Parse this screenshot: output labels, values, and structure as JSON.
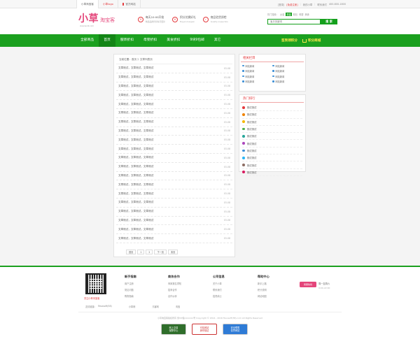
{
  "topbar": {
    "items": [
      "小草淘宝客",
      "小草logo",
      "官方网站"
    ],
    "right": [
      "[登录]",
      "[免费注册]",
      "我的小草",
      "联系我们",
      "400-800-1800"
    ]
  },
  "header": {
    "logo_big": "小草",
    "logo_small": "淘宝客",
    "logo_url": "xiaocao-tk.com",
    "features": [
      {
        "icon": "9",
        "title": "每天10:00开抢",
        "sub": "精选品牌折扣每天更新"
      },
      {
        "icon": "¥",
        "title": "积分兑换好礼",
        "sub": "Buyers bargain"
      },
      {
        "icon": "✓",
        "title": "商品验货质检",
        "sub": "Quality inspection"
      }
    ],
    "hot_search_label": "热门搜索：",
    "hot_search": [
      "女装",
      "男装",
      "鞋包",
      "母婴",
      "美食"
    ],
    "search_placeholder": "宝贝关键词",
    "search_button": "搜 索"
  },
  "nav": {
    "items": [
      "全部商品",
      "首页",
      "服饰折扣",
      "母婴折扣",
      "美食折扣",
      "9块9包邮",
      "其它"
    ],
    "active_index": 1,
    "right": [
      "签到领积分",
      "积分商城"
    ],
    "accent": "#1ba01f"
  },
  "main": {
    "breadcrumb": "当前位置：首页 》文章列表页",
    "articles": [
      {
        "title": "文章测试，文章测试，文章测试",
        "date": "03-08"
      },
      {
        "title": "文章测试，文章测试，文章测试",
        "date": "03-08"
      },
      {
        "title": "文章测试，文章测试，文章测试",
        "date": "03-08"
      },
      {
        "title": "文章测试，文章测试，文章测试",
        "date": "03-08"
      },
      {
        "title": "文章测试，文章测试，文章测试",
        "date": "03-08"
      },
      {
        "title": "文章测试，文章测试，文章测试",
        "date": "03-08"
      },
      {
        "title": "文章测试，文章测试，文章测试",
        "date": "03-08"
      },
      {
        "title": "文章测试，文章测试，文章测试",
        "date": "03-08"
      },
      {
        "title": "文章测试，文章测试，文章测试",
        "date": "03-08"
      },
      {
        "title": "文章测试，文章测试，文章测试",
        "date": "03-08"
      },
      {
        "title": "文章测试，文章测试，文章测试",
        "date": "03-08"
      },
      {
        "title": "文章测试，文章测试，文章测试",
        "date": "03-08"
      },
      {
        "title": "文章测试，文章测试，文章测试",
        "date": "03-08"
      },
      {
        "title": "文章测试，文章测试，文章测试",
        "date": "03-08"
      },
      {
        "title": "文章测试，文章测试，文章测试",
        "date": "03-08"
      },
      {
        "title": "文章测试，文章测试，文章测试",
        "date": "03-08"
      },
      {
        "title": "文章测试，文章测试，文章测试",
        "date": "03-08"
      },
      {
        "title": "文章测试，文章测试，文章测试",
        "date": "03-08"
      },
      {
        "title": "文章测试，文章测试，文章测试",
        "date": "03-08"
      },
      {
        "title": "文章测试，文章测试，文章测试",
        "date": "03-08"
      }
    ],
    "pager": [
      "首页",
      "1",
      "2",
      "下一页",
      "末页"
    ]
  },
  "sidebar": {
    "related_title": "相关栏目",
    "related": [
      "网站新闻",
      "网站新闻",
      "网站新闻",
      "网站新闻",
      "网站新闻",
      "网站新闻",
      "网站新闻",
      "网站新闻"
    ],
    "rank_title": "热门排行",
    "rank": [
      "测试测试",
      "测试测试",
      "测试测试",
      "测试测试",
      "测试测试",
      "测试测试",
      "测试测试",
      "测试测试",
      "测试测试",
      "测试测试"
    ],
    "rank_colors": [
      "#e4393c",
      "#f08300",
      "#f5b800",
      "#4caf50",
      "#26a69a",
      "#ab47bc",
      "#3d8fd6",
      "#29b6f6",
      "#8d6e63",
      "#d81b60"
    ]
  },
  "footer": {
    "qr_label": "关注小草淘宝客",
    "columns": [
      {
        "title": "新手指南",
        "links": [
          "用户注册",
          "常见问题",
          "购物指南"
        ]
      },
      {
        "title": "商务合作",
        "links": [
          "商家报名须知",
          "招商合作",
          "合作伙伴"
        ]
      },
      {
        "title": "公司信息",
        "links": [
          "关于小草",
          "联系我们",
          "招贤纳士"
        ]
      },
      {
        "title": "帮助中心",
        "links": [
          "新手上路",
          "积分说明",
          "网站地图"
        ]
      }
    ],
    "tel_box": "客服热线",
    "tel_a": "周一至周六",
    "tel_b": "9:00-22:00",
    "links_label": "友情链接：",
    "links": [
      "Favosoft(58)",
      "小草网",
      "凡客网",
      "淘宝"
    ],
    "copyright": "小草淘宝客版权所有 浙ICP备xxxxxxx号  Copyright © 2014 - 2016 Favosoft(58).com All Rights Reserved",
    "badges": [
      "网上交易\n保障中心",
      "可信网站\n身份验证",
      "安全联盟\n信誉网站"
    ]
  }
}
